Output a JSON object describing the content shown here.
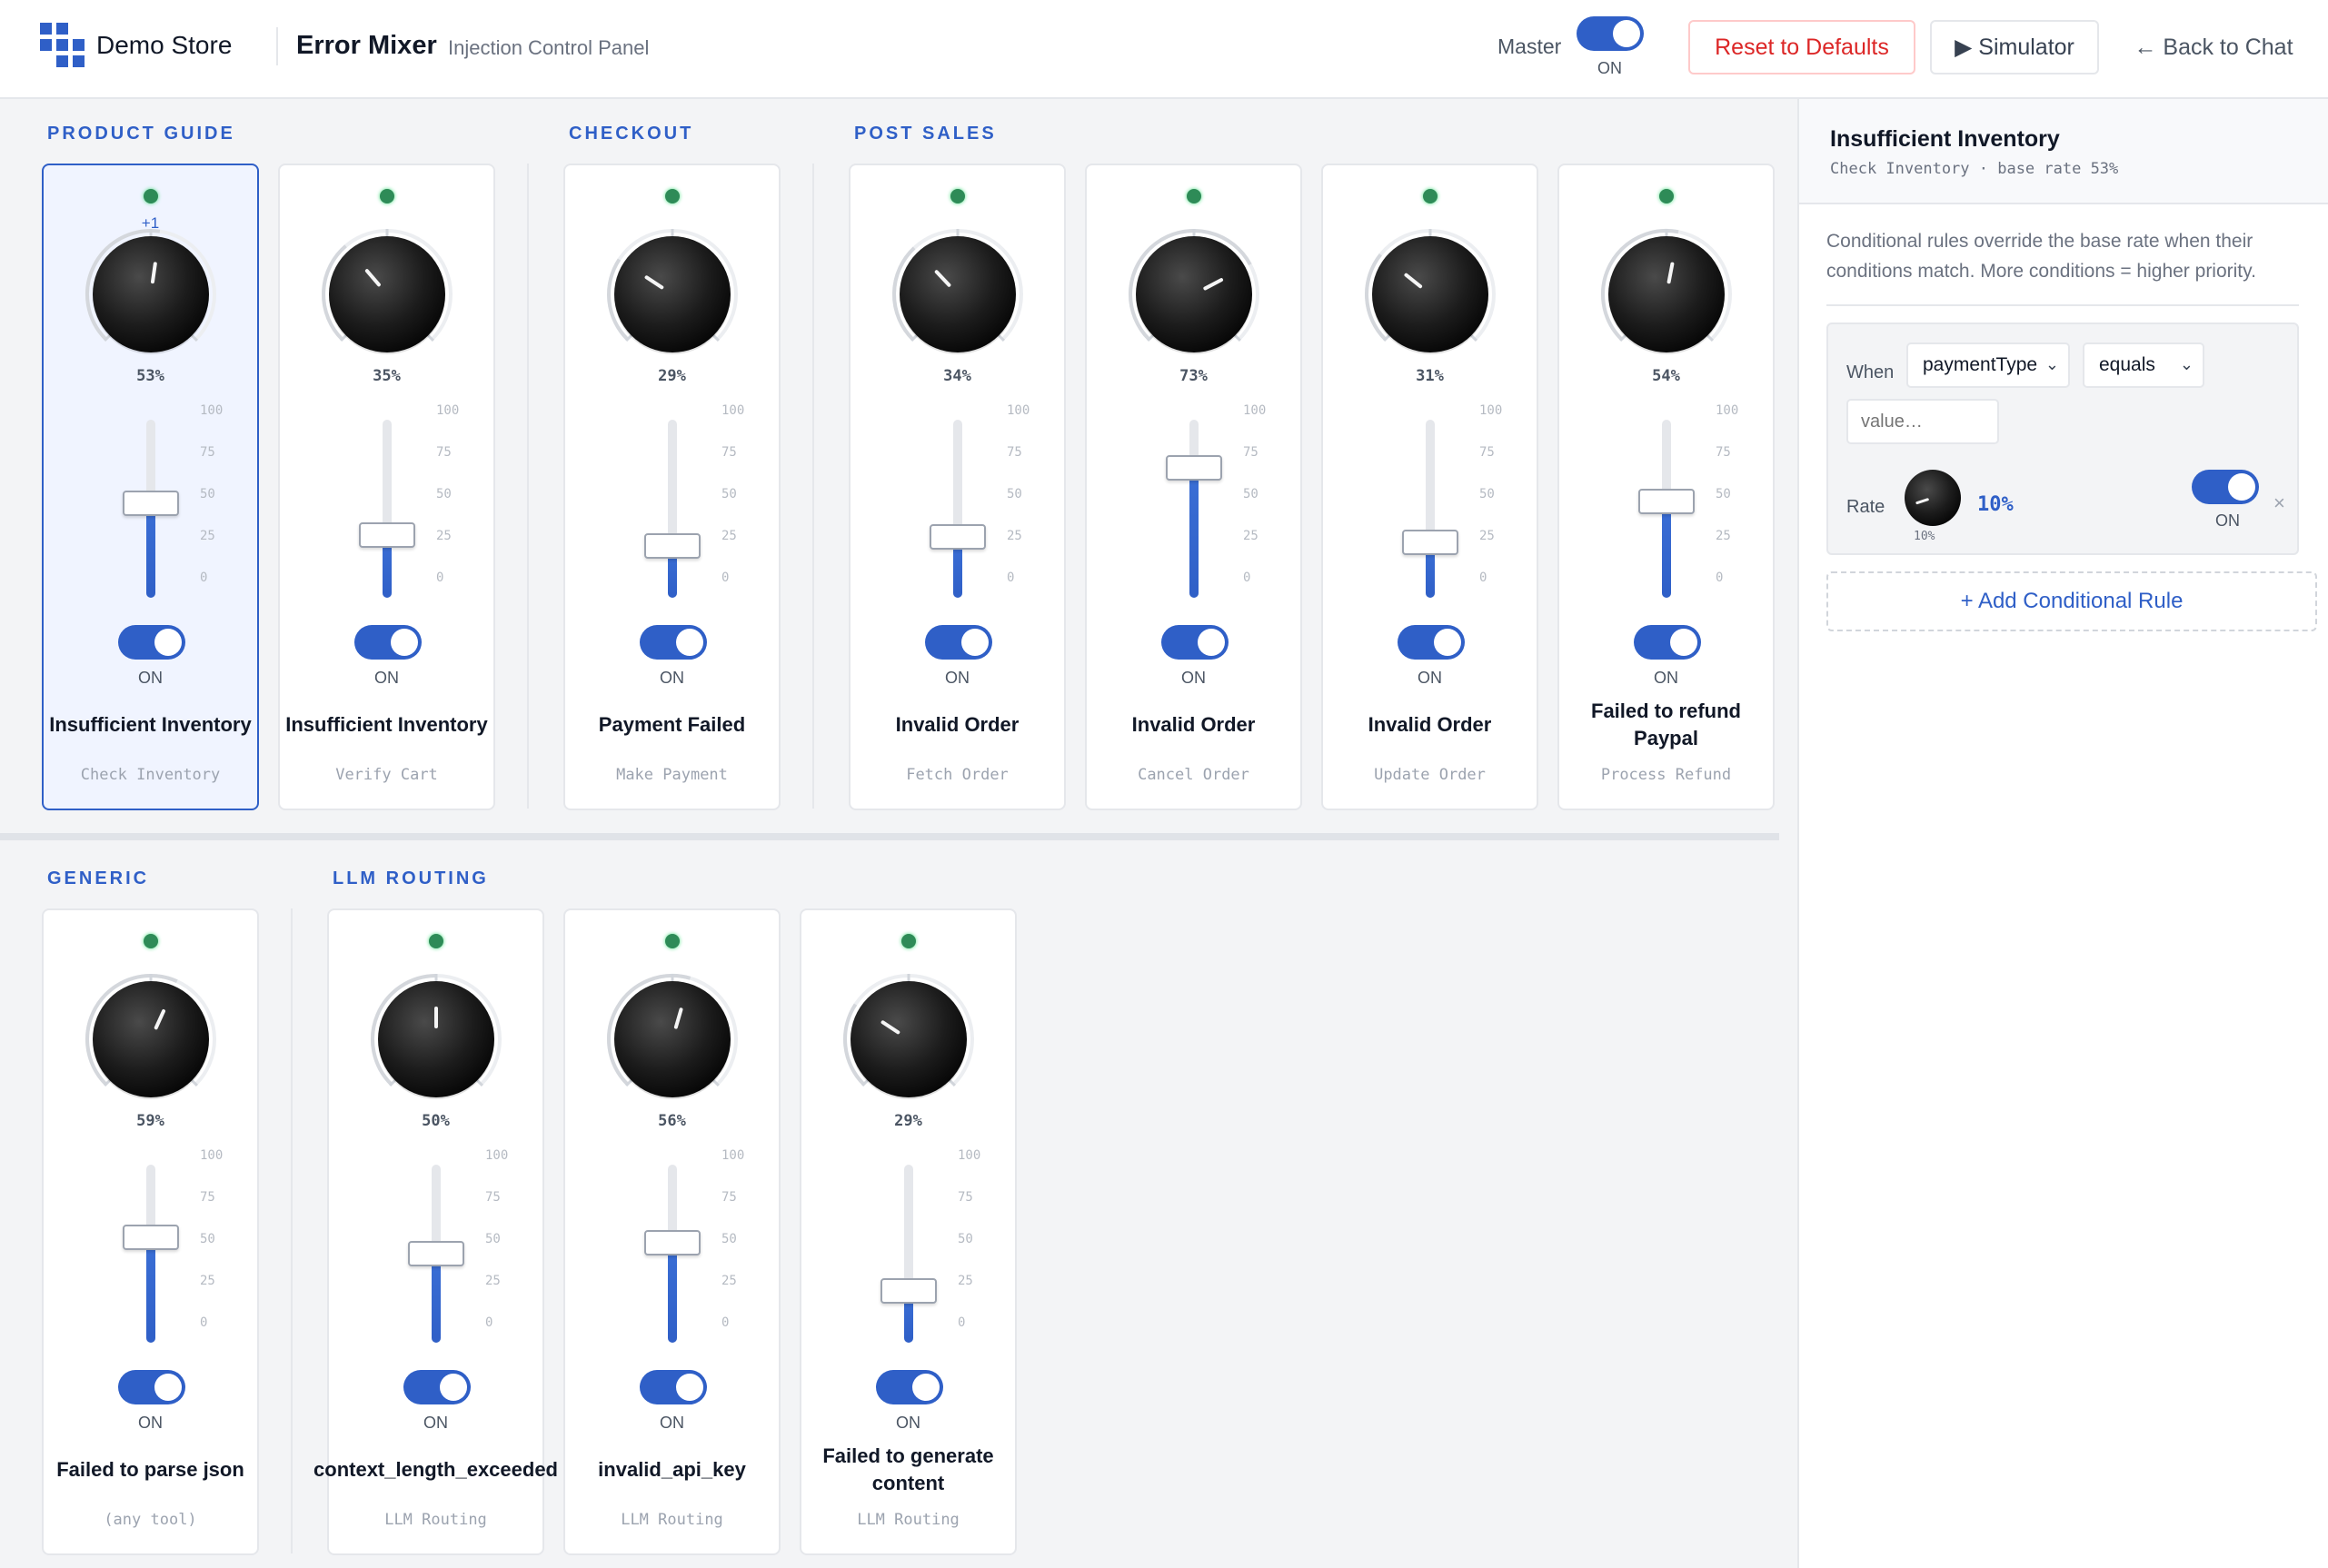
{
  "header": {
    "logo_text": "Demo Store",
    "title": "Error Mixer",
    "subtitle": "Injection Control Panel",
    "master_label": "Master",
    "master_state": "ON",
    "reset_label": "Reset to Defaults",
    "simulator_label": "▶ Simulator",
    "back_label": "← Back to Chat"
  },
  "scale_labels": [
    "100",
    "75",
    "50",
    "25",
    "0"
  ],
  "sections": [
    {
      "label": "PRODUCT GUIDE"
    },
    {
      "label": "CHECKOUT"
    },
    {
      "label": "POST SALES"
    },
    {
      "label": "GENERIC"
    },
    {
      "label": "LLM ROUTING"
    }
  ],
  "channels": [
    {
      "name": "Insufficient Inventory",
      "tool": "Check Inventory",
      "percent_label": "53%",
      "rate": 53,
      "state": "ON",
      "delta": "+1",
      "selected": true
    },
    {
      "name": "Insufficient Inventory",
      "tool": "Verify Cart",
      "percent_label": "35%",
      "rate": 35,
      "state": "ON"
    },
    {
      "name": "Payment Failed",
      "tool": "Make Payment",
      "percent_label": "29%",
      "rate": 29,
      "state": "ON"
    },
    {
      "name": "Invalid Order",
      "tool": "Fetch Order",
      "percent_label": "34%",
      "rate": 34,
      "state": "ON"
    },
    {
      "name": "Invalid Order",
      "tool": "Cancel Order",
      "percent_label": "73%",
      "rate": 73,
      "state": "ON"
    },
    {
      "name": "Invalid Order",
      "tool": "Update Order",
      "percent_label": "31%",
      "rate": 31,
      "state": "ON"
    },
    {
      "name": "Failed to refund Paypal",
      "tool": "Process Refund",
      "percent_label": "54%",
      "rate": 54,
      "state": "ON"
    },
    {
      "name": "Failed to parse json",
      "tool": "(any tool)",
      "percent_label": "59%",
      "rate": 59,
      "state": "ON"
    },
    {
      "name": "context_length_exceeded",
      "tool": "LLM Routing",
      "percent_label": "50%",
      "rate": 50,
      "state": "ON"
    },
    {
      "name": "invalid_api_key",
      "tool": "LLM Routing",
      "percent_label": "56%",
      "rate": 56,
      "state": "ON"
    },
    {
      "name": "Failed to generate content",
      "tool": "LLM Routing",
      "percent_label": "29%",
      "rate": 29,
      "state": "ON"
    }
  ],
  "panel": {
    "title": "Insufficient Inventory",
    "subtitle": "Check Inventory · base rate 53%",
    "description": "Conditional rules override the base rate when their conditions match. More conditions = higher priority.",
    "rule": {
      "when_label": "When",
      "field": "paymentType",
      "operator": "equals",
      "value_placeholder": "value…",
      "rate_label": "Rate",
      "rate_value": "10%",
      "rate_knob_label": "10%",
      "rate": 10,
      "state": "ON",
      "delete_glyph": "×"
    },
    "add_rule_label": "+ Add Conditional Rule"
  },
  "colors": {
    "accent": "#2f5fc7",
    "led": "#2e8b57",
    "danger": "#dc2626"
  }
}
